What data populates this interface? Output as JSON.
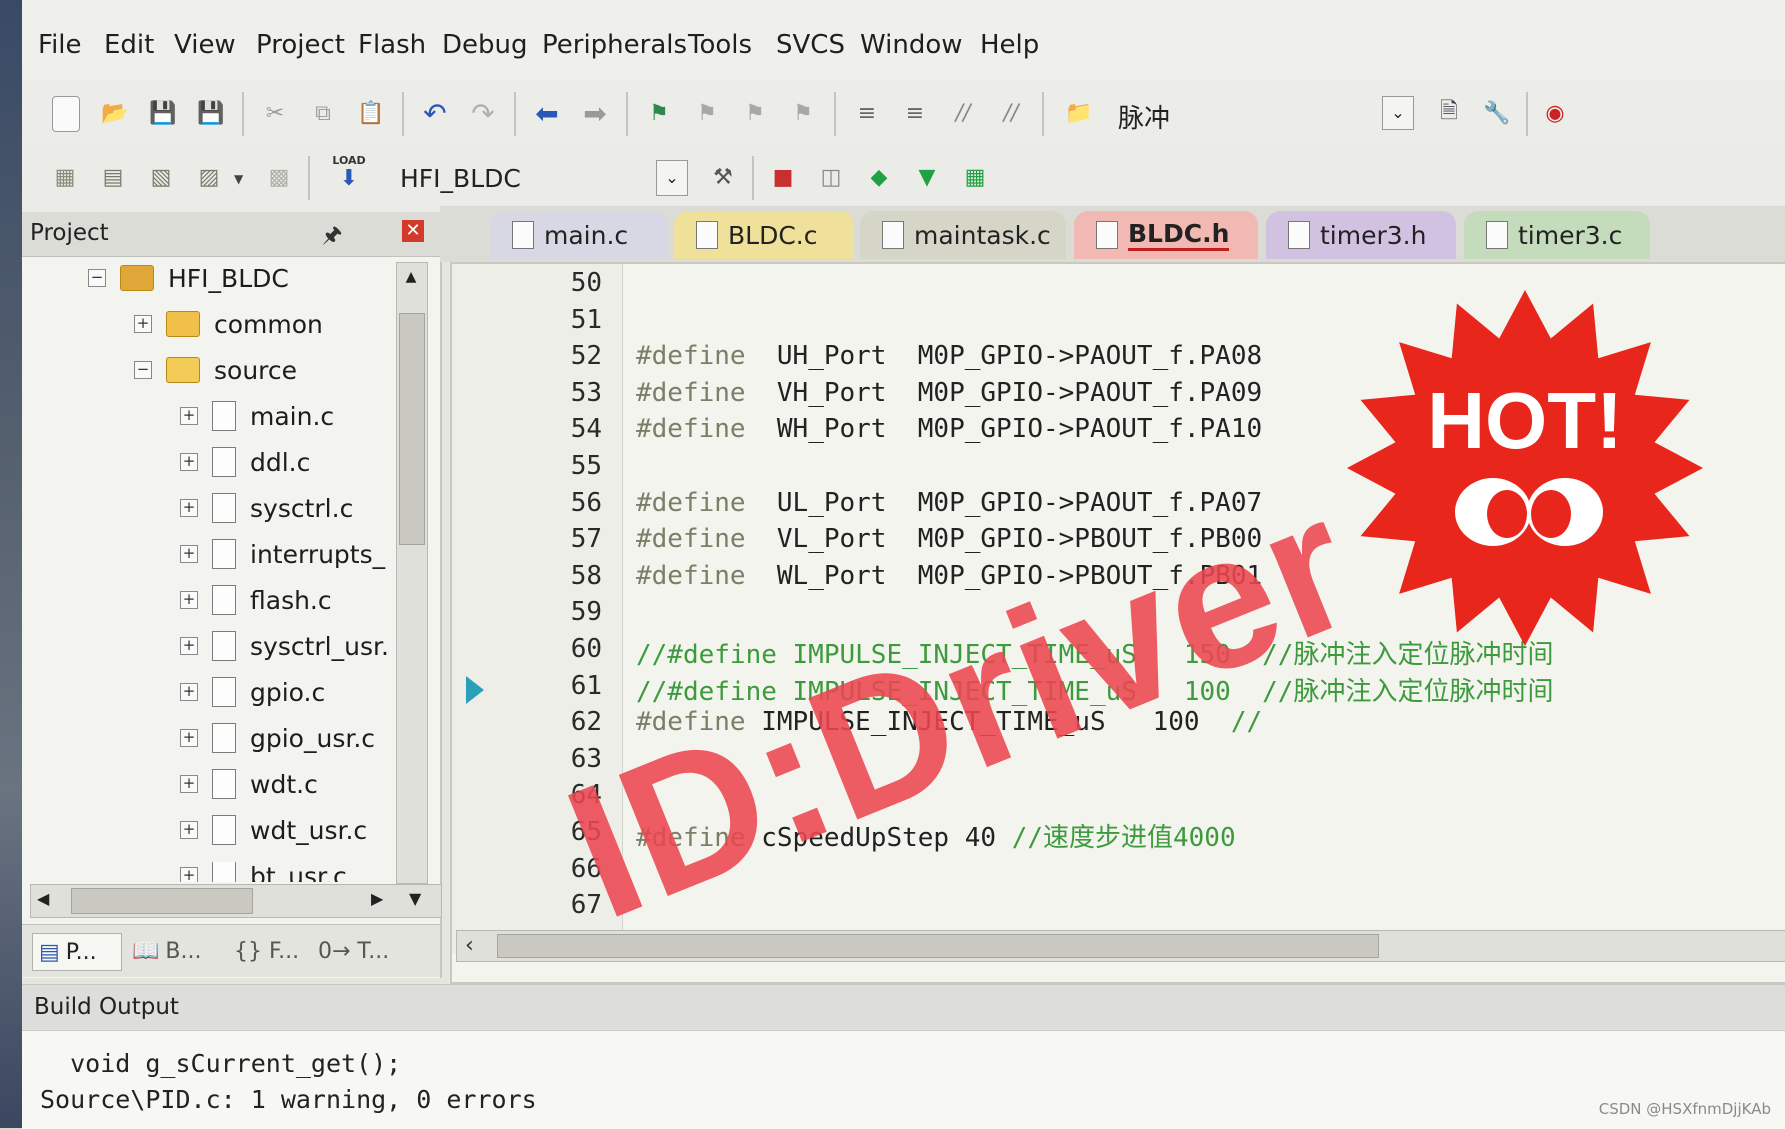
{
  "menu": [
    "File",
    "Edit",
    "View",
    "Project",
    "Flash",
    "Debug",
    "Peripherals",
    "Tools",
    "SVCS",
    "Window",
    "Help"
  ],
  "toolbar": {
    "find_text": "脉冲",
    "target_name": "HFI_BLDC",
    "load_label": "LOAD"
  },
  "project_panel": {
    "title": "Project",
    "root": "HFI_BLDC",
    "folders": [
      "common",
      "source"
    ],
    "files": [
      "main.c",
      "ddl.c",
      "sysctrl.c",
      "interrupts_",
      "flash.c",
      "sysctrl_usr.",
      "gpio.c",
      "gpio_usr.c",
      "wdt.c",
      "wdt_usr.c",
      "bt_usr.c"
    ],
    "bottom_tabs": [
      "P...",
      "B...",
      "{} F...",
      "0→ T..."
    ]
  },
  "tabs": [
    {
      "label": "main.c",
      "color": "#d8d8e4"
    },
    {
      "label": "BLDC.c",
      "color": "#efe19a"
    },
    {
      "label": "maintask.c",
      "color": "#d6d6c8"
    },
    {
      "label": "BLDC.h",
      "color": "#f1b8b4"
    },
    {
      "label": "timer3.h",
      "color": "#d2c2e2"
    },
    {
      "label": "timer3.c",
      "color": "#c4dcbc"
    }
  ],
  "editor": {
    "line_numbers": [
      "50",
      "51",
      "52",
      "53",
      "54",
      "55",
      "56",
      "57",
      "58",
      "59",
      "60",
      "61",
      "62",
      "63",
      "64",
      "65",
      "66",
      "67"
    ],
    "lines": [
      {
        "kw": "",
        "rest": ""
      },
      {
        "kw": "",
        "rest": ""
      },
      {
        "kw": "#define",
        "rest": "  UH_Port  M0P_GPIO->PAOUT_f.PA08"
      },
      {
        "kw": "#define",
        "rest": "  VH_Port  M0P_GPIO->PAOUT_f.PA09"
      },
      {
        "kw": "#define",
        "rest": "  WH_Port  M0P_GPIO->PAOUT_f.PA10"
      },
      {
        "kw": "",
        "rest": ""
      },
      {
        "kw": "#define",
        "rest": "  UL_Port  M0P_GPIO->PAOUT_f.PA07"
      },
      {
        "kw": "#define",
        "rest": "  VL_Port  M0P_GPIO->PBOUT_f.PB00"
      },
      {
        "kw": "#define",
        "rest": "  WL_Port  M0P_GPIO->PBOUT_f.PB01"
      },
      {
        "kw": "",
        "rest": ""
      },
      {
        "comment": "//#define IMPULSE_INJECT_TIME_uS   150  //脉冲注入定位脉冲时间"
      },
      {
        "comment": "//#define IMPULSE_INJECT_TIME_uS   100  //脉冲注入定位脉冲时间"
      },
      {
        "kw": "#define",
        "rest": " IMPULSE_INJECT_TIME_uS   100  //"
      },
      {
        "kw": "",
        "rest": ""
      },
      {
        "kw": "",
        "rest": ""
      },
      {
        "kw": "#define",
        "rest": " cSpeedUpStep 40 //速度步进值4000"
      },
      {
        "kw": "",
        "rest": ""
      },
      {
        "kw": "",
        "rest": ""
      }
    ]
  },
  "build_output": {
    "title": "Build Output",
    "lines": [
      "  void g_sCurrent_get();",
      "Source\\PID.c: 1 warning, 0 errors"
    ]
  },
  "overlay": {
    "badge_text": "HOT!",
    "watermark": "ID:Driver",
    "credit": "CSDN @HSXfnmDjjKAb"
  }
}
